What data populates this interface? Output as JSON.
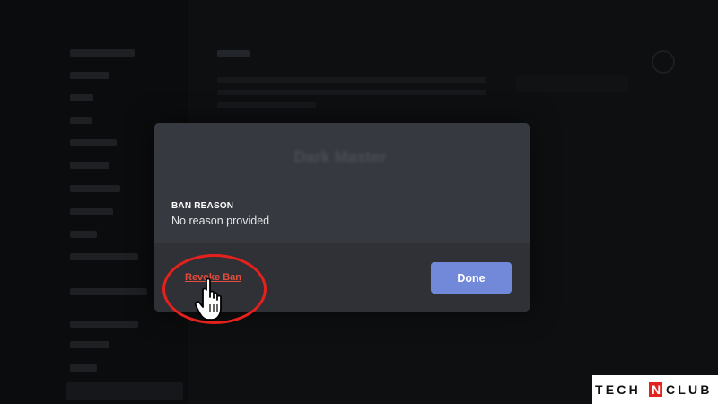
{
  "modal": {
    "title": "Dark Master",
    "ban_reason_label": "BAN REASON",
    "ban_reason_value": "No reason provided",
    "revoke_button_label": "Revoke Ban",
    "done_button_label": "Done"
  },
  "watermark": {
    "brand": "TECHNCLUB",
    "brand_color": "#e5211e"
  },
  "colors": {
    "modal_bg": "#36393f",
    "footer_bg": "#2f3136",
    "accent": "#7289da",
    "danger": "#e74c3c",
    "annotation": "#e5211e"
  }
}
